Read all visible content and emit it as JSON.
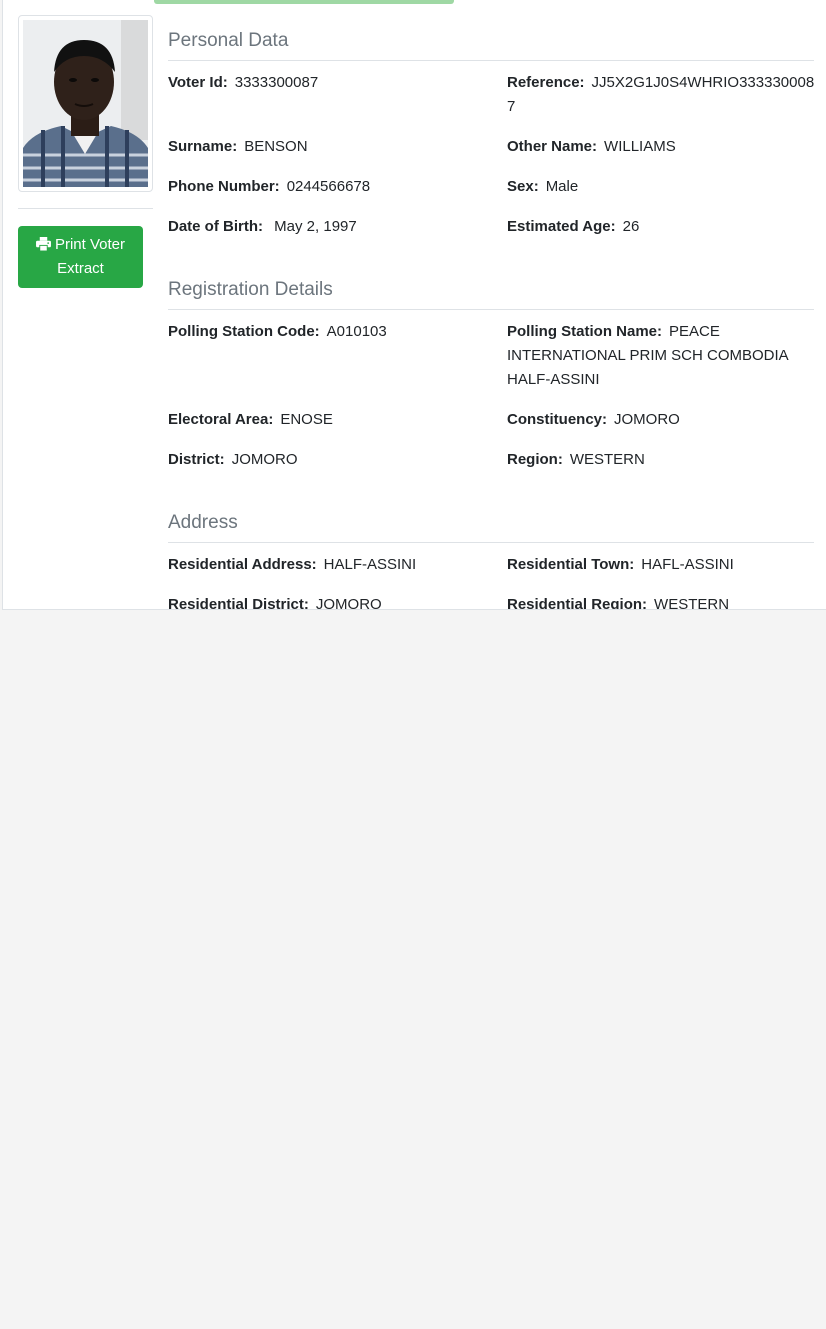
{
  "actions": {
    "print_label": "Print Voter Extract"
  },
  "personal": {
    "title": "Personal Data",
    "voter_id_label": "Voter Id:",
    "voter_id": "3333300087",
    "reference_label": "Reference:",
    "reference": "JJ5X2G1J0S4WHRIO3333300087",
    "surname_label": "Surname:",
    "surname": "BENSON",
    "other_name_label": "Other Name:",
    "other_name": "WILLIAMS",
    "phone_label": "Phone Number:",
    "phone": "0244566678",
    "sex_label": "Sex:",
    "sex": "Male",
    "dob_label": "Date of Birth:",
    "dob": "May 2, 1997",
    "age_label": "Estimated Age:",
    "age": "26"
  },
  "registration": {
    "title": "Registration Details",
    "ps_code_label": "Polling Station Code:",
    "ps_code": "A010103",
    "ps_name_label": "Polling Station Name:",
    "ps_name": "PEACE INTERNATIONAL PRIM SCH COMBODIA HALF-ASSINI",
    "electoral_area_label": "Electoral Area:",
    "electoral_area": "ENOSE",
    "constituency_label": "Constituency:",
    "constituency": "JOMORO",
    "district_label": "District:",
    "district": "JOMORO",
    "region_label": "Region:",
    "region": "WESTERN"
  },
  "address": {
    "title": "Address",
    "res_address_label": "Residential Address:",
    "res_address": "HALF-ASSINI",
    "res_town_label": "Residential Town:",
    "res_town": "HAFL-ASSINI",
    "res_district_label": "Residential District:",
    "res_district": "JOMORO",
    "res_region_label": "Residential Region:",
    "res_region": "WESTERN"
  }
}
